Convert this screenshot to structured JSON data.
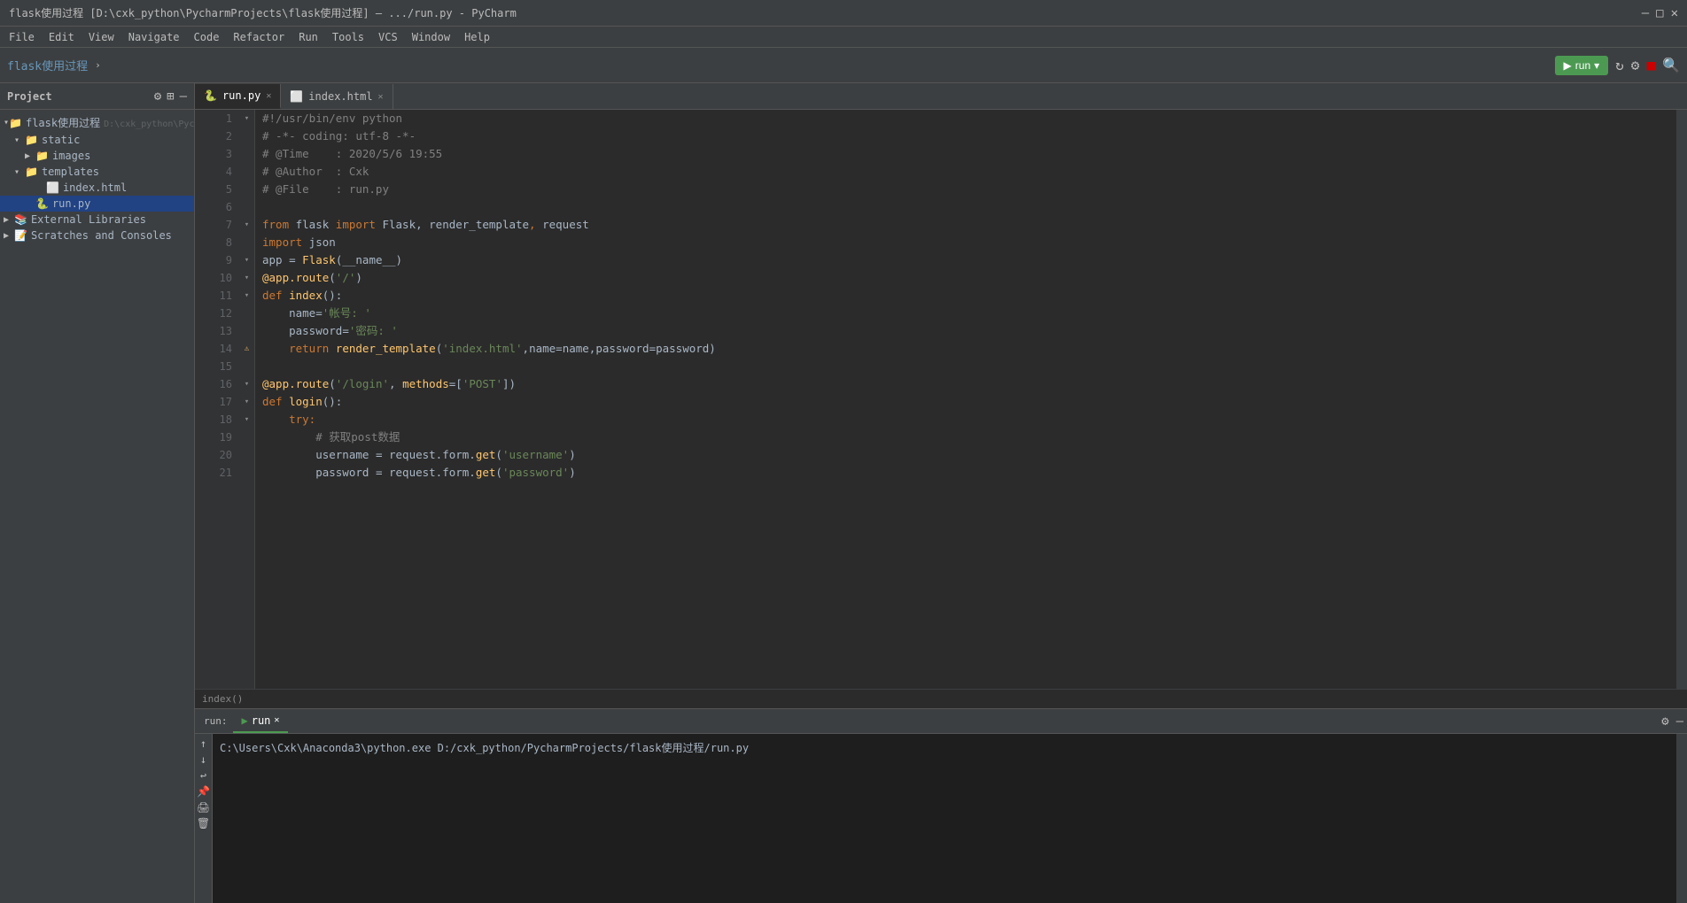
{
  "window": {
    "title": "flask使用过程 [D:\\cxk_python\\PycharmProjects\\flask使用过程] – .../run.py - PyCharm"
  },
  "menubar": {
    "items": [
      "File",
      "Edit",
      "View",
      "Navigate",
      "Code",
      "Refactor",
      "Run",
      "Tools",
      "VCS",
      "Window",
      "Help"
    ]
  },
  "toolbar": {
    "breadcrumb": "flask使用过程",
    "run_label": "run",
    "run_config": "run ▾"
  },
  "sidebar": {
    "title": "Project",
    "root_label": "flask使用过程 D:\\cxk_python\\PycharmProjects\\flask使用过程",
    "items": [
      {
        "label": "static",
        "type": "folder",
        "indent": 1,
        "expanded": true
      },
      {
        "label": "images",
        "type": "folder",
        "indent": 2,
        "expanded": false
      },
      {
        "label": "templates",
        "type": "folder",
        "indent": 1,
        "expanded": true
      },
      {
        "label": "index.html",
        "type": "html",
        "indent": 3
      },
      {
        "label": "run.py",
        "type": "py",
        "indent": 2,
        "selected": true
      },
      {
        "label": "External Libraries",
        "type": "lib",
        "indent": 0
      },
      {
        "label": "Scratches and Consoles",
        "type": "scratch",
        "indent": 0
      }
    ]
  },
  "tabs": [
    {
      "label": "run.py",
      "type": "py",
      "active": true
    },
    {
      "label": "index.html",
      "type": "html",
      "active": false
    }
  ],
  "code_lines": [
    {
      "num": 1,
      "content": "#!/usr/bin/env python",
      "type": "shebang"
    },
    {
      "num": 2,
      "content": "# -*- coding: utf-8 -*-",
      "type": "comment"
    },
    {
      "num": 3,
      "content": "# @Time    : 2020/5/6 19:55",
      "type": "comment"
    },
    {
      "num": 4,
      "content": "# @Author  : Cxk",
      "type": "comment"
    },
    {
      "num": 5,
      "content": "# @File    : run.py",
      "type": "comment"
    },
    {
      "num": 6,
      "content": "",
      "type": "blank"
    },
    {
      "num": 7,
      "content": "from flask import Flask, render_template, request",
      "type": "import"
    },
    {
      "num": 8,
      "content": "import json",
      "type": "import"
    },
    {
      "num": 9,
      "content": "app = Flask(__name__)",
      "type": "code"
    },
    {
      "num": 10,
      "content": "@app.route('/')",
      "type": "decorator"
    },
    {
      "num": 11,
      "content": "def index():",
      "type": "def"
    },
    {
      "num": 12,
      "content": "    name='帐号: '",
      "type": "code"
    },
    {
      "num": 13,
      "content": "    password='密码: '",
      "type": "code"
    },
    {
      "num": 14,
      "content": "    return render_template('index.html', name=name, password=password)",
      "type": "code"
    },
    {
      "num": 15,
      "content": "",
      "type": "blank"
    },
    {
      "num": 16,
      "content": "@app.route('/login', methods=['POST'])",
      "type": "decorator"
    },
    {
      "num": 17,
      "content": "def login():",
      "type": "def"
    },
    {
      "num": 18,
      "content": "    try:",
      "type": "code"
    },
    {
      "num": 19,
      "content": "        # 获取post数据",
      "type": "comment"
    },
    {
      "num": 20,
      "content": "        username = request.form.get('username')",
      "type": "code"
    },
    {
      "num": 21,
      "content": "        password = request.form.get('password')",
      "type": "code_partial"
    }
  ],
  "bottom_panel": {
    "tab_label": "run",
    "tab_close": "✕",
    "terminal_command": "C:\\Users\\Cxk\\Anaconda3\\python.exe D:/cxk_python/PycharmProjects/flask使用过程/run.py",
    "status_line": "index()"
  }
}
